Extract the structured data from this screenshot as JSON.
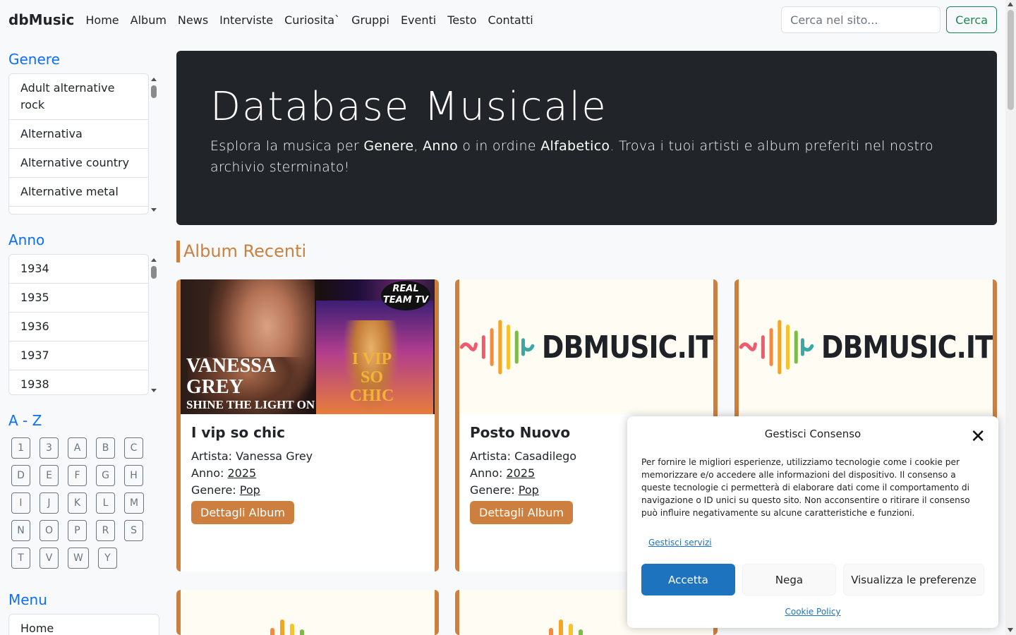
{
  "navbar": {
    "brand": "dbMusic",
    "links": [
      "Home",
      "Album",
      "News",
      "Interviste",
      "Curiosita`",
      "Gruppi",
      "Eventi",
      "Testo",
      "Contatti"
    ],
    "search_placeholder": "Cerca nel sito...",
    "search_button": "Cerca"
  },
  "sidebar": {
    "genre_heading": "Genere",
    "genres": [
      "Adult alternative rock",
      "Alternativa",
      "Alternative country",
      "Alternative metal"
    ],
    "year_heading": "Anno",
    "years": [
      "1934",
      "1935",
      "1936",
      "1937",
      "1938"
    ],
    "az_heading": "A - Z",
    "az_letters": [
      "1",
      "3",
      "A",
      "B",
      "C",
      "D",
      "E",
      "F",
      "G",
      "H",
      "I",
      "J",
      "K",
      "L",
      "M",
      "N",
      "O",
      "P",
      "R",
      "S",
      "T",
      "V",
      "W",
      "Y"
    ],
    "menu_heading": "Menu",
    "menu_items": [
      "Home"
    ]
  },
  "hero": {
    "title": "Database Musicale",
    "text_1": "Esplora la musica per ",
    "bold_1": "Genere",
    "text_2": ", ",
    "bold_2": "Anno",
    "text_3": " o in ordine ",
    "bold_3": "Alfabetico",
    "text_4": ". Trova i tuoi artisti e album preferiti nel nostro archivio sterminato!"
  },
  "section_title": "Album Recenti",
  "album_labels": {
    "artist": "Artista: ",
    "year": "Anno: ",
    "genre": "Genere: ",
    "details_button": "Dettagli Album"
  },
  "albums": [
    {
      "title": "I vip so chic",
      "artist": "Vanessa Grey",
      "year": "2025",
      "genre": "Pop",
      "cover_text_name": "VANESSA GREY",
      "cover_text_tagline": "SHINE THE LIGHT ON",
      "cover_text_title": "I VIP SO CHIC",
      "cover_badge": "REAL TEAM TV"
    },
    {
      "title": "Posto Nuovo",
      "artist": "Casadilego",
      "year": "2025",
      "genre": "Pop",
      "cover_logo": "DBMUSIC.IT"
    },
    {
      "cover_logo": "DBMUSIC.IT"
    }
  ],
  "consent": {
    "title": "Gestisci Consenso",
    "body": "Per fornire le migliori esperienze, utilizziamo tecnologie come i cookie per memorizzare e/o accedere alle informazioni del dispositivo. Il consenso a queste tecnologie ci permetterà di elaborare dati come il comportamento di navigazione o ID unici su questo sito. Non acconsentire o ritirare il consenso può influire negativamente su alcune caratteristiche e funzioni.",
    "manage_services": "Gestisci servizi",
    "accept": "Accetta",
    "deny": "Nega",
    "preferences": "Visualizza le preferenze",
    "cookie_policy": "Cookie Policy"
  },
  "colors": {
    "accent": "#cc7f3f",
    "link_blue": "#0d6efd",
    "hero_bg": "#212529",
    "success": "#198754",
    "consent_blue": "#1e73be"
  }
}
